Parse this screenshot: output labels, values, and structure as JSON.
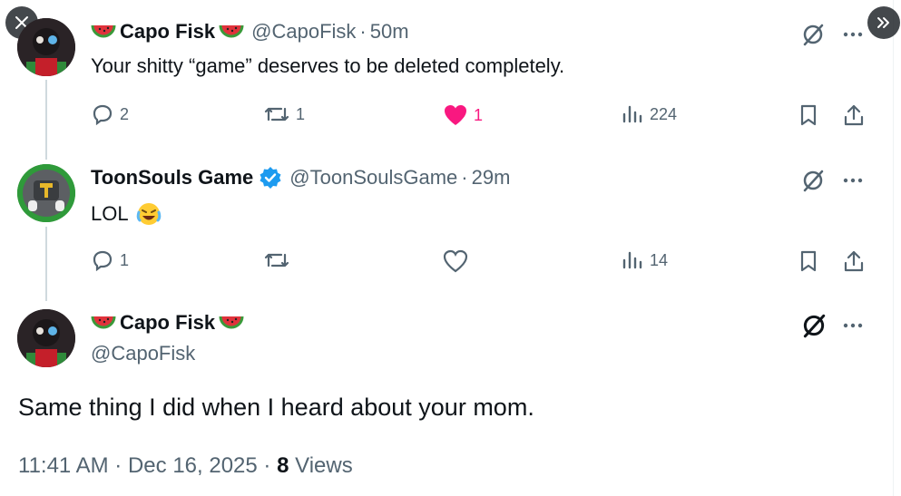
{
  "overlay": {
    "close_icon": "close-icon",
    "next_icon": "chevron-double-right-icon"
  },
  "tweets": [
    {
      "name": "Capo Fisk",
      "handle": "@CapoFisk",
      "separator": "·",
      "time": "50m",
      "text": "Your shitty “game” deserves to be deleted completely.",
      "replies": "2",
      "reposts": "1",
      "likes": "1",
      "views": "224",
      "liked": true
    },
    {
      "name": "ToonSouls Game",
      "handle": "@ToonSoulsGame",
      "separator": "·",
      "time": "29m",
      "text": "LOL",
      "replies": "1",
      "reposts": "",
      "likes": "",
      "views": "14",
      "verified": true
    }
  ],
  "main_tweet": {
    "name": "Capo Fisk",
    "handle": "@CapoFisk",
    "text": "Same thing I did when I heard about your mom.",
    "time": "11:41 AM",
    "separator": "·",
    "date": "Dec 16, 2025",
    "views_count": "8",
    "views_label": "Views"
  },
  "colors": {
    "like_pink": "#f91880",
    "verified_blue": "#1d9bf0",
    "muted": "#536471"
  }
}
